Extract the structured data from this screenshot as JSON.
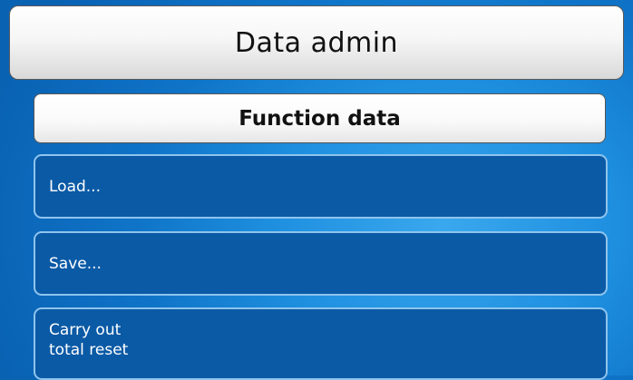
{
  "header": {
    "title": "Data admin"
  },
  "section": {
    "title": "Function data"
  },
  "menu": {
    "items": [
      {
        "label": "Load..."
      },
      {
        "label": "Save..."
      },
      {
        "label_line1": "Carry out",
        "label_line2": "total reset"
      }
    ]
  },
  "colors": {
    "background": "#1a88d8",
    "button_fill": "#0b5aa6",
    "button_border": "#8ec4ee",
    "header_fill": "#f4f4f4"
  }
}
